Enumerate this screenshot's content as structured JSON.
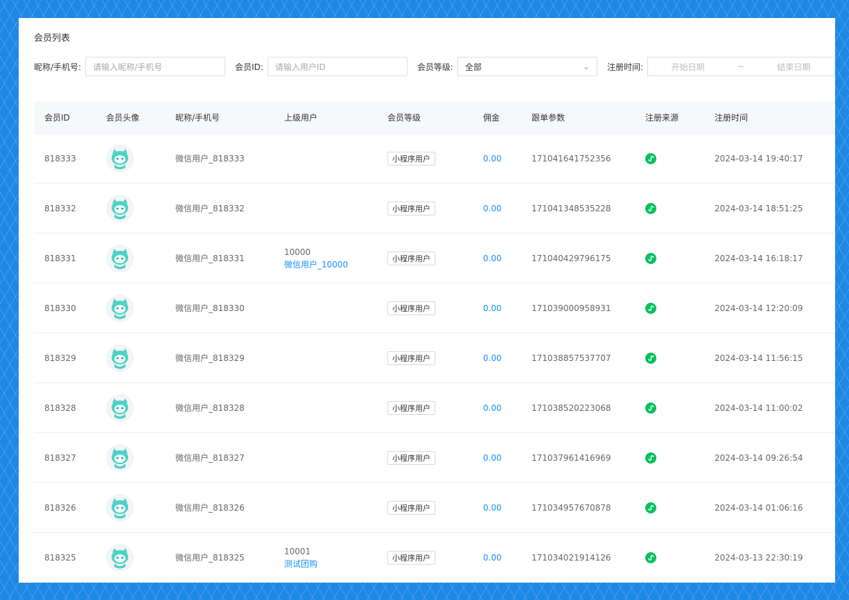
{
  "page": {
    "title": "会员列表"
  },
  "filters": {
    "nickname_label": "昵称/手机号:",
    "nickname_placeholder": "请输入昵称/手机号",
    "member_id_label": "会员ID:",
    "member_id_placeholder": "请输入用户ID",
    "level_label": "会员等级:",
    "level_value": "全部",
    "reg_time_label": "注册时间:",
    "start_placeholder": "开始日期",
    "separator": "~",
    "end_placeholder": "结束日期"
  },
  "table": {
    "headers": [
      "会员ID",
      "会员头像",
      "昵称/手机号",
      "上级用户",
      "会员等级",
      "佣金",
      "跟单参数",
      "注册来源",
      "注册时间"
    ],
    "rows": [
      {
        "id": "818333",
        "nickname": "微信用户_818333",
        "superior_id": "",
        "superior_name": "",
        "level": "小程序用户",
        "commission": "0.00",
        "param": "171041641752356",
        "time": "2024-03-14 19:40:17"
      },
      {
        "id": "818332",
        "nickname": "微信用户_818332",
        "superior_id": "",
        "superior_name": "",
        "level": "小程序用户",
        "commission": "0.00",
        "param": "171041348535228",
        "time": "2024-03-14 18:51:25"
      },
      {
        "id": "818331",
        "nickname": "微信用户_818331",
        "superior_id": "10000",
        "superior_name": "微信用户_10000",
        "level": "小程序用户",
        "commission": "0.00",
        "param": "171040429796175",
        "time": "2024-03-14 16:18:17"
      },
      {
        "id": "818330",
        "nickname": "微信用户_818330",
        "superior_id": "",
        "superior_name": "",
        "level": "小程序用户",
        "commission": "0.00",
        "param": "171039000958931",
        "time": "2024-03-14 12:20:09"
      },
      {
        "id": "818329",
        "nickname": "微信用户_818329",
        "superior_id": "",
        "superior_name": "",
        "level": "小程序用户",
        "commission": "0.00",
        "param": "171038857537707",
        "time": "2024-03-14 11:56:15"
      },
      {
        "id": "818328",
        "nickname": "微信用户_818328",
        "superior_id": "",
        "superior_name": "",
        "level": "小程序用户",
        "commission": "0.00",
        "param": "171038520223068",
        "time": "2024-03-14 11:00:02"
      },
      {
        "id": "818327",
        "nickname": "微信用户_818327",
        "superior_id": "",
        "superior_name": "",
        "level": "小程序用户",
        "commission": "0.00",
        "param": "171037961416969",
        "time": "2024-03-14 09:26:54"
      },
      {
        "id": "818326",
        "nickname": "微信用户_818326",
        "superior_id": "",
        "superior_name": "",
        "level": "小程序用户",
        "commission": "0.00",
        "param": "171034957670878",
        "time": "2024-03-14 01:06:16"
      },
      {
        "id": "818325",
        "nickname": "微信用户_818325",
        "superior_id": "10001",
        "superior_name": "测试团购",
        "level": "小程序用户",
        "commission": "0.00",
        "param": "171034021914126",
        "time": "2024-03-13 22:30:19"
      }
    ]
  },
  "icons": {
    "avatar": "cat-avatar-icon",
    "source": "mini-program-icon",
    "chevron": "chevron-down-icon"
  },
  "colors": {
    "link": "#1890ff",
    "source_green": "#07c160",
    "avatar_teal": "#4fd1c5",
    "background_blue": "#1e88e5"
  }
}
